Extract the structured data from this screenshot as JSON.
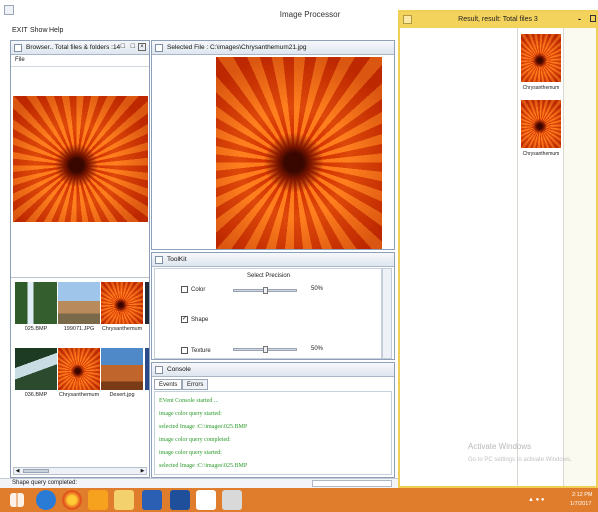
{
  "main_window": {
    "title": "Image Processor",
    "menu": [
      "EXIT",
      "Show",
      "Help"
    ]
  },
  "browser": {
    "title": "Browser.. Total files & folders :14",
    "menu_file": "File",
    "thumbnails": [
      {
        "caption": "025.BMP",
        "kind": "pic-waterfall"
      },
      {
        "caption": "199071.JPG",
        "kind": "pic-ruins"
      },
      {
        "caption": "Chrysanthemum",
        "kind": "flower"
      },
      {
        "caption": "036.BMP",
        "kind": "pic-falls2"
      },
      {
        "caption": "Chrysanthemum",
        "kind": "flower"
      },
      {
        "caption": "Desert.jpg",
        "kind": "pic-desert"
      }
    ]
  },
  "selected_file": {
    "title": "Selected File : C:\\images\\Chrysanthemum21.jpg"
  },
  "toolkit": {
    "title": "ToolKit",
    "heading": "Select Precision",
    "options": [
      {
        "label": "Color",
        "checked": false,
        "value": "50%",
        "level": 0.5
      },
      {
        "label": "Shape",
        "checked": true,
        "value": "",
        "level": null
      },
      {
        "label": "Texture",
        "checked": false,
        "value": "50%",
        "level": 0.5
      }
    ]
  },
  "console": {
    "title": "Console",
    "tabs": [
      "Events",
      "Errors"
    ],
    "lines": [
      "EVent Console started ...",
      "image color query started:",
      "selected Image :C:\\images\\025.BMP",
      "image color query completed:",
      "image color query started:",
      "selected Image :C:\\images\\025.BMP"
    ]
  },
  "status_bar": {
    "text": "Shape query completed:"
  },
  "result_window": {
    "title": "Result, result: Total files 3",
    "minimize": "-",
    "items": [
      {
        "caption": "Chrysanthemum"
      },
      {
        "caption": "Chrysanthemum"
      }
    ],
    "watermark_title": "Activate Windows",
    "watermark_sub": "Go to PC settings to activate Windows."
  },
  "taskbar": {
    "time": "2:12 PM",
    "date": "1/7/2017"
  }
}
